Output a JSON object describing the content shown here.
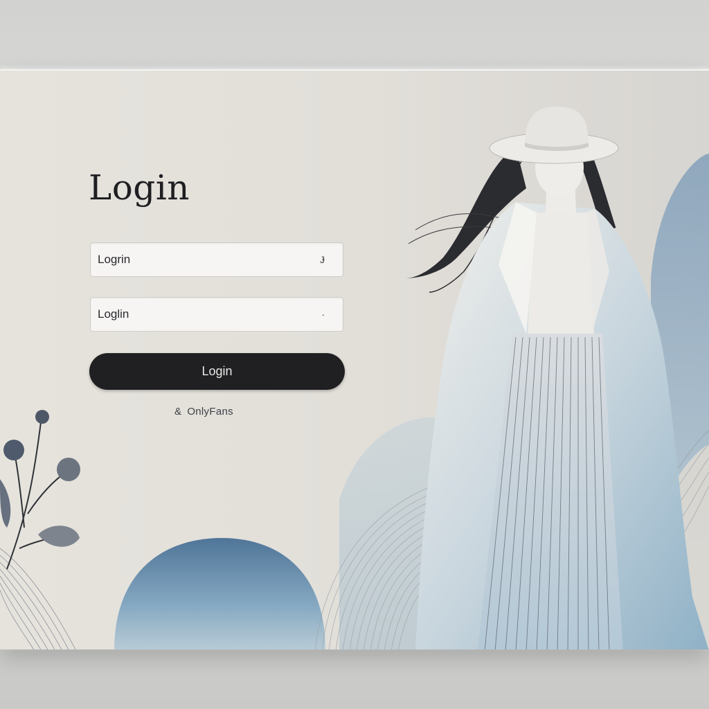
{
  "login_form": {
    "title": "Login",
    "username_value": "Logrin",
    "password_value": "Loglin",
    "username_marker": "Ɉ",
    "password_marker": "·",
    "submit_label": "Login"
  },
  "brand": {
    "icon": "ampersand-icon",
    "glyph": "&",
    "name": "OnlyFans"
  },
  "colors": {
    "button_bg": "#202022",
    "panel_bg": "#e2dfd9",
    "accent_blue": "#6d93b3"
  }
}
